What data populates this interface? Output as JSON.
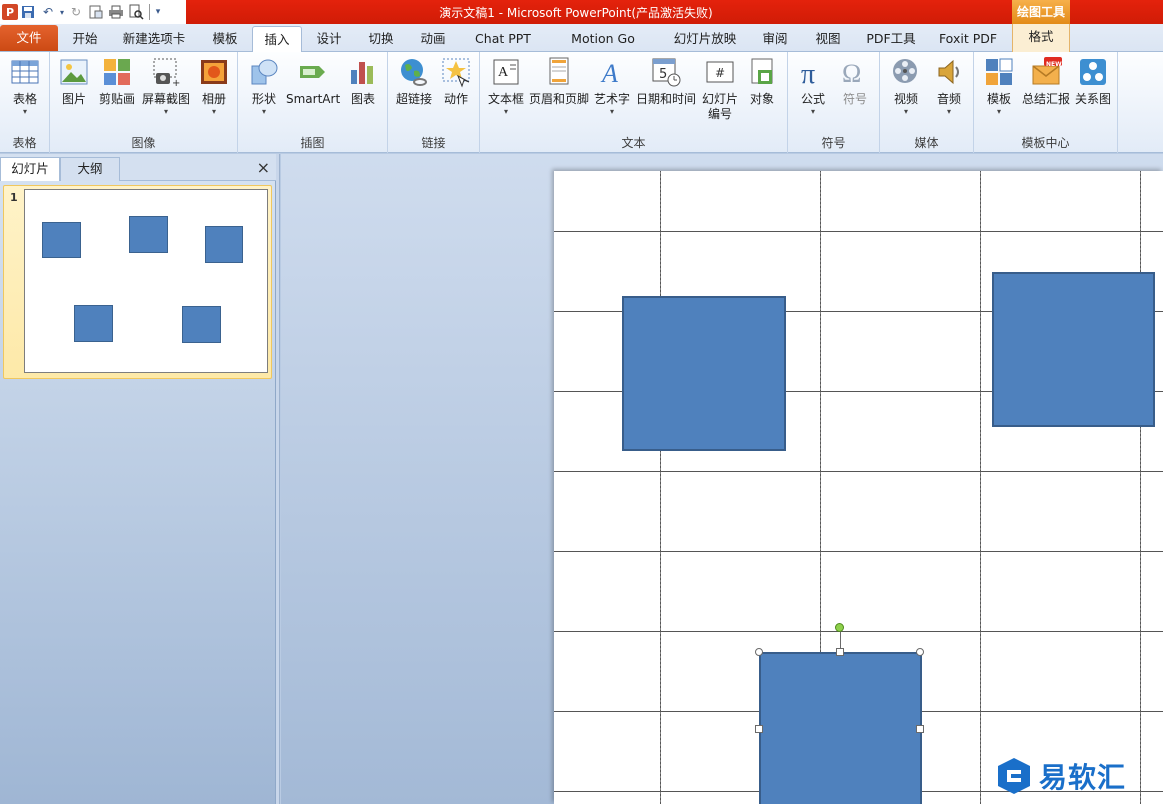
{
  "window": {
    "title": "演示文稿1 - Microsoft PowerPoint(产品激活失败)",
    "context_tool": "绘图工具"
  },
  "tabs": [
    "文件",
    "开始",
    "新建选项卡",
    "模板",
    "插入",
    "设计",
    "切换",
    "动画",
    "Chat PPT",
    "Motion Go",
    "幻灯片放映",
    "审阅",
    "视图",
    "PDF工具",
    "Foxit PDF",
    "格式"
  ],
  "active_tab": "插入",
  "ribbon": {
    "groups": {
      "table": {
        "label": "表格",
        "buttons": [
          "表格"
        ]
      },
      "image": {
        "label": "图像",
        "buttons": [
          "图片",
          "剪贴画",
          "屏幕截图",
          "相册"
        ]
      },
      "illustration": {
        "label": "插图",
        "buttons": [
          "形状",
          "SmartArt",
          "图表"
        ]
      },
      "link": {
        "label": "链接",
        "buttons": [
          "超链接",
          "动作"
        ]
      },
      "text": {
        "label": "文本",
        "buttons": [
          "文本框",
          "页眉和页脚",
          "艺术字",
          "日期和时间",
          "幻灯片",
          "编号",
          "对象"
        ]
      },
      "symbol": {
        "label": "符号",
        "buttons": [
          "公式",
          "符号"
        ]
      },
      "media": {
        "label": "媒体",
        "buttons": [
          "视频",
          "音频"
        ]
      },
      "template_center": {
        "label": "模板中心",
        "buttons": [
          "模板",
          "总结汇报",
          "关系图"
        ],
        "badge": "NEW"
      }
    }
  },
  "panel": {
    "tabs": [
      "幻灯片",
      "大纲"
    ],
    "close": "×",
    "slide_number": "1"
  },
  "watermark": {
    "text": "易软汇"
  },
  "colors": {
    "shape_fill": "#4f81bd",
    "shape_border": "#385d8a",
    "title_bar": "#d01c06",
    "file_tab": "#cc4a14"
  }
}
